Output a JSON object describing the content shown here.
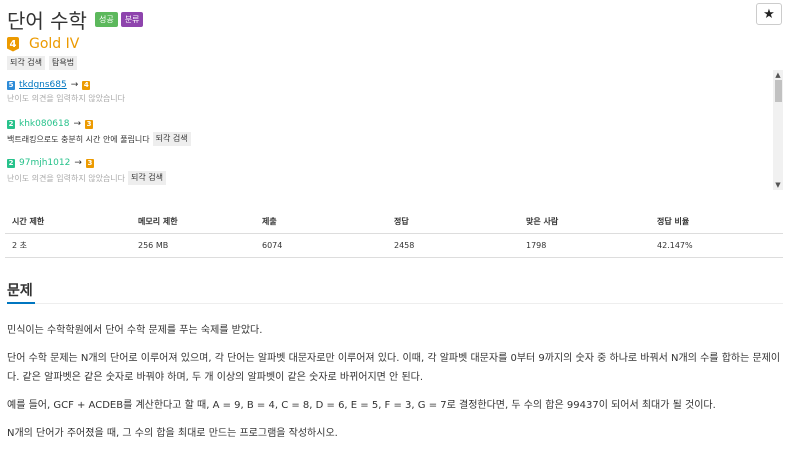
{
  "problem": {
    "title": "단어 수학",
    "badges": [
      "성공",
      "분류"
    ]
  },
  "star_button": "★",
  "tier": {
    "number": "4",
    "label": "Gold IV"
  },
  "tags": [
    "되각 검색",
    "탐욕법"
  ],
  "opinions": [
    {
      "level": "5",
      "user": "tkdgns685",
      "arrow": "→",
      "target_level": "4",
      "text": "난이도 의견을 입력하지 않았습니다",
      "tags": []
    },
    {
      "level": "2",
      "user": "khk080618",
      "arrow": "→",
      "target_level": "3",
      "text": "백트래킹으로도 충분히 시간 안에 풀립니다",
      "tags": [
        "되각 검색"
      ]
    },
    {
      "level": "2",
      "user": "97mjh1012",
      "arrow": "→",
      "target_level": "3",
      "text": "난이도 의견을 입력하지 않았습니다",
      "tags": [
        "되각 검색"
      ]
    }
  ],
  "stats": {
    "headers": [
      "시간 제한",
      "메모리 제한",
      "제출",
      "정답",
      "맞은 사람",
      "정답 비율"
    ],
    "values": [
      "2 초",
      "256 MB",
      "6074",
      "2458",
      "1798",
      "42.147%"
    ]
  },
  "section": {
    "title": "문제"
  },
  "description": [
    "민식이는 수학학원에서 단어 수학 문제를 푸는 숙제를 받았다.",
    "단어 수학 문제는 N개의 단어로 이루어져 있으며, 각 단어는 알파벳 대문자로만 이루어져 있다. 이때, 각 알파벳 대문자를 0부터 9까지의 숫자 중 하나로 바꿔서 N개의 수를 합하는 문제이다. 같은 알파벳은 같은 숫자로 바꿔야 하며, 두 개 이상의 알파벳이 같은 숫자로 바뀌어지면 안 된다.",
    "예를 들어, GCF + ACDEB를 계산한다고 할 때, A = 9, B = 4, C = 8, D = 6, E = 5, F = 3, G = 7로 결정한다면, 두 수의 합은 99437이 되어서 최대가 될 것이다.",
    "N개의 단어가 주어졌을 때, 그 수의 합을 최대로 만드는 프로그램을 작성하시오."
  ]
}
